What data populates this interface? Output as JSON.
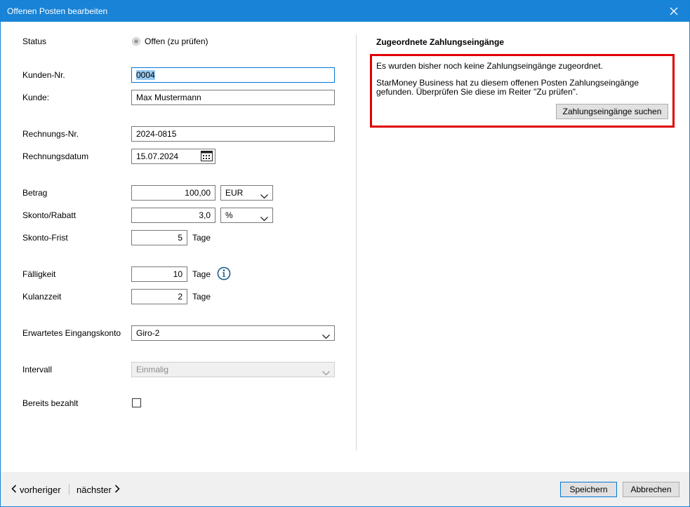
{
  "window": {
    "title": "Offenen Posten bearbeiten"
  },
  "form": {
    "status": {
      "label": "Status",
      "value": "Offen (zu prüfen)"
    },
    "kunden_nr": {
      "label": "Kunden-Nr.",
      "value": "0004"
    },
    "kunde": {
      "label": "Kunde:",
      "value": "Max Mustermann"
    },
    "rechnungs_nr": {
      "label": "Rechnungs-Nr.",
      "value": "2024-0815"
    },
    "rechnungsdatum": {
      "label": "Rechnungsdatum",
      "value": "15.07.2024"
    },
    "betrag": {
      "label": "Betrag",
      "value": "100,00",
      "currency": "EUR"
    },
    "skonto": {
      "label": "Skonto/Rabatt",
      "value": "3,0",
      "unit": "%"
    },
    "skonto_frist": {
      "label": "Skonto-Frist",
      "value": "5",
      "unit": "Tage"
    },
    "faelligkeit": {
      "label": "Fälligkeit",
      "value": "10",
      "unit": "Tage"
    },
    "kulanzzeit": {
      "label": "Kulanzzeit",
      "value": "2",
      "unit": "Tage"
    },
    "eingangskonto": {
      "label": "Erwartetes Eingangskonto",
      "value": "Giro-2"
    },
    "intervall": {
      "label": "Intervall",
      "value": "Einmalig"
    },
    "bereits_bezahlt": {
      "label": "Bereits bezahlt",
      "checked": false
    }
  },
  "panel": {
    "title": "Zugeordnete Zahlungseingänge",
    "message1": "Es wurden bisher noch keine Zahlungseingänge zugeordnet.",
    "message2": "StarMoney Business hat zu diesem offenen Posten Zahlungseingänge gefunden. Überprüfen Sie diese im Reiter \"Zu prüfen\".",
    "search_button": "Zahlungseingänge suchen"
  },
  "footer": {
    "prev": "vorheriger",
    "next": "nächster",
    "save": "Speichern",
    "cancel": "Abbrechen"
  },
  "colors": {
    "titlebar": "#1883d7",
    "highlight_border": "#e00000",
    "info_icon": "#1f5f8b"
  }
}
